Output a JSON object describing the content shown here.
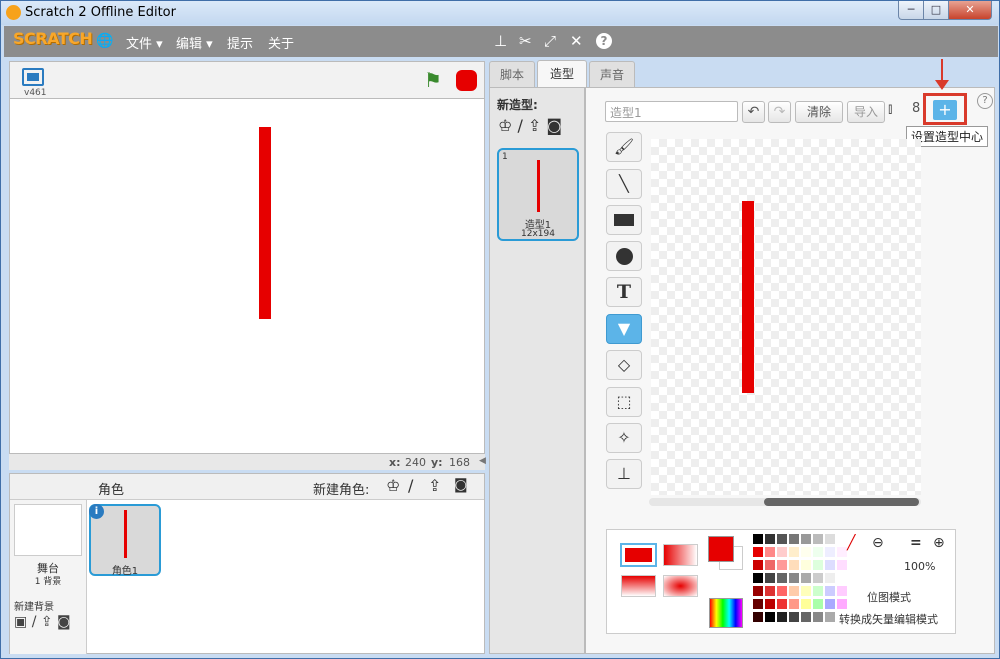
{
  "window": {
    "title": "Scratch 2 Offline Editor",
    "minimize": "─",
    "maximize": "□",
    "close": "✕"
  },
  "menubar": {
    "logo": "SCRATCH",
    "globe": "🌐",
    "file": "文件 ▾",
    "edit": "编辑 ▾",
    "tips": "提示",
    "about": "关于",
    "icons": [
      "stamp-icon",
      "cut-icon",
      "grow-icon",
      "shrink-icon",
      "help-icon"
    ]
  },
  "stage": {
    "version": "v461",
    "x_label": "x:",
    "x_value": "240",
    "y_label": "y:",
    "y_value": "168"
  },
  "sprites": {
    "header": "角色",
    "new_sprite": "新建角色:",
    "stage_label": "舞台",
    "backdrops": "1 背景",
    "new_backdrop": "新建背景",
    "sprite_name": "角色1",
    "info": "i"
  },
  "tabs": {
    "scripts": "脚本",
    "costumes": "造型",
    "sounds": "声音"
  },
  "costumes": {
    "new_costume": "新造型:",
    "index": "1",
    "name": "造型1",
    "size": "12x194"
  },
  "editor": {
    "costume_name": "造型1",
    "undo": "↶",
    "redo": "↷",
    "clear": "清除",
    "import": "导入",
    "set_center_tooltip": "设置造型中心",
    "zoom": "100%",
    "convert_vector": "转换成矢量编辑模式",
    "bitmap_mode": "位图模式",
    "help": "?"
  },
  "colors": {
    "primary": "#e60000",
    "accent": "#5cb4e8",
    "highlight": "#d93a2b"
  }
}
